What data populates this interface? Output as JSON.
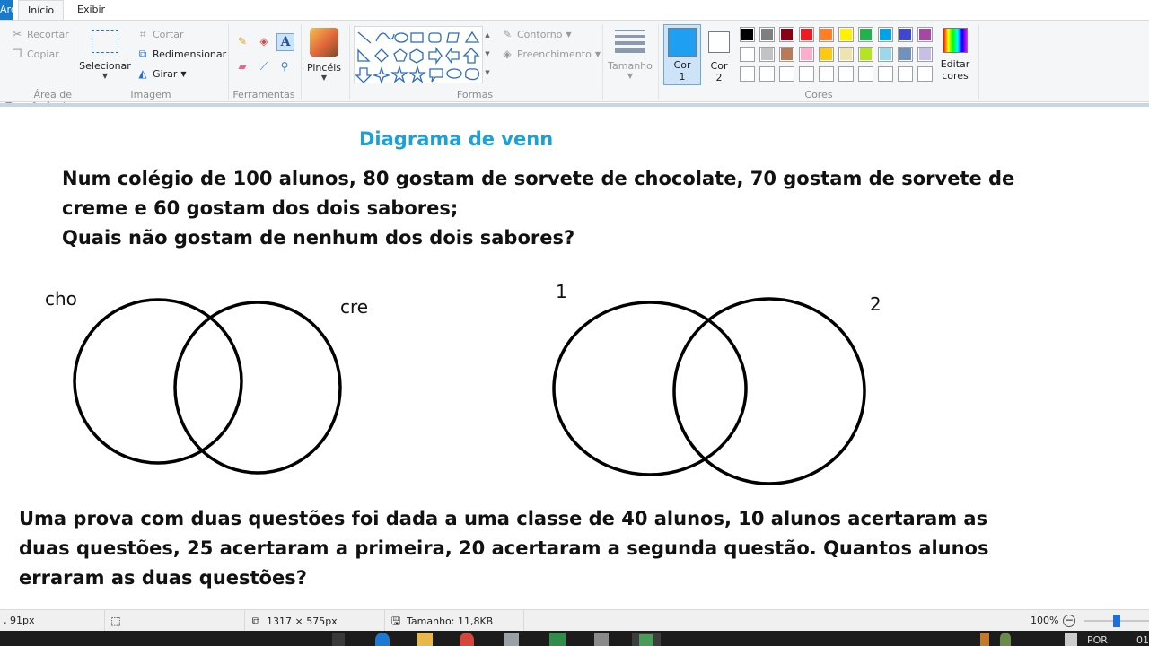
{
  "tabs": {
    "file": "Arquivo",
    "home": "Início",
    "view": "Exibir"
  },
  "ribbon": {
    "clipboard": {
      "cut": "Recortar",
      "copy": "Copiar",
      "label": "Área de Transferência"
    },
    "image": {
      "select": "Selecionar",
      "crop": "Cortar",
      "resize": "Redimensionar",
      "rotate": "Girar",
      "label": "Imagem"
    },
    "tools": {
      "label": "Ferramentas"
    },
    "brushes": {
      "label": "Pincéis"
    },
    "shapes": {
      "outline": "Contorno",
      "fill": "Preenchimento",
      "label": "Formas"
    },
    "size": {
      "label": "Tamanho"
    },
    "color1": {
      "label1": "Cor",
      "label2": "1",
      "value": "#1e9ff2"
    },
    "color2": {
      "label1": "Cor",
      "label2": "2",
      "value": "#ffffff"
    },
    "palette": {
      "row1": [
        "#000000",
        "#7f7f7f",
        "#880015",
        "#ed1c24",
        "#ff7f27",
        "#fff200",
        "#22b14c",
        "#00a2e8",
        "#3f48cc",
        "#a349a4"
      ],
      "row2": [
        "#ffffff",
        "#c3c3c3",
        "#b97a57",
        "#ffaec9",
        "#ffc90e",
        "#efe4b0",
        "#b5e61d",
        "#99d9ea",
        "#7092be",
        "#c8bfe7"
      ],
      "row3": [
        "#ffffff",
        "#ffffff",
        "#ffffff",
        "#ffffff",
        "#ffffff",
        "#ffffff",
        "#ffffff",
        "#ffffff",
        "#ffffff",
        "#ffffff"
      ],
      "label": "Cores"
    },
    "edit_colors": {
      "line1": "Editar",
      "line2": "cores"
    }
  },
  "canvas": {
    "title": "Diagrama de venn",
    "problem1": {
      "line1": "Num colégio de 100 alunos, 80 gostam de sorvete de chocolate, 70 gostam de sorvete de",
      "line2": "creme e 60 gostam dos dois sabores;",
      "line3": "Quais não gostam de nenhum dos dois sabores?"
    },
    "venn1": {
      "left_label": "cho",
      "right_label": "cre"
    },
    "venn2": {
      "left_label": "1",
      "right_label": "2"
    },
    "problem2": {
      "line1": "Uma prova com duas questões foi dada a uma classe de 40 alunos, 10 alunos acertaram as",
      "line2": "duas questões, 25 acertaram a primeira, 20 acertaram a segunda questão. Quantos alunos",
      "line3": "erraram as duas questões?"
    }
  },
  "status": {
    "cursor": ", 91px",
    "dimensions": "1317 × 575px",
    "size": "Tamanho: 11,8KB",
    "zoom": "100%",
    "zoom_level": 0.5
  },
  "taskbar": {
    "lang": "POR",
    "time": "01"
  }
}
